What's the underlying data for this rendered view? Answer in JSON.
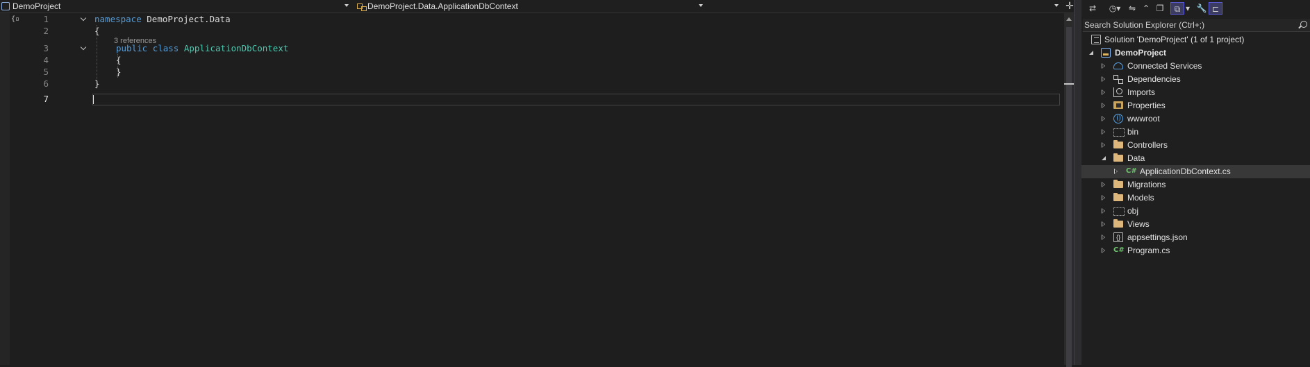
{
  "navbar": {
    "project": "DemoProject",
    "class_path": "DemoProject.Data.ApplicationDbContext",
    "member": ""
  },
  "editor": {
    "line_numbers": [
      "1",
      "2",
      "3",
      "4",
      "5",
      "6",
      "7"
    ],
    "current_line": "7",
    "codelens": "3 references",
    "code": {
      "l1_kw": "namespace",
      "l1_name": "DemoProject.Data",
      "l2": "{",
      "l3_kw1": "public",
      "l3_kw2": "class",
      "l3_type": "ApplicationDbContext",
      "l4": "{",
      "l5": "}",
      "l6": "}"
    }
  },
  "solution_explorer": {
    "search_placeholder": "Search Solution Explorer (Ctrl+;)",
    "items": [
      {
        "label": "Solution 'DemoProject' (1 of 1 project)",
        "icon": "solution-icon"
      },
      {
        "label": "DemoProject",
        "icon": "project-icon"
      },
      {
        "label": "Connected Services",
        "icon": "connected-services-icon"
      },
      {
        "label": "Dependencies",
        "icon": "dependencies-icon"
      },
      {
        "label": "Imports",
        "icon": "imports-icon"
      },
      {
        "label": "Properties",
        "icon": "properties-icon"
      },
      {
        "label": "wwwroot",
        "icon": "globe-icon"
      },
      {
        "label": "bin",
        "icon": "folder-icon"
      },
      {
        "label": "Controllers",
        "icon": "folder-icon"
      },
      {
        "label": "Data",
        "icon": "folder-icon"
      },
      {
        "label": "ApplicationDbContext.cs",
        "icon": "csharp-file-icon"
      },
      {
        "label": "Migrations",
        "icon": "folder-icon"
      },
      {
        "label": "Models",
        "icon": "folder-icon"
      },
      {
        "label": "obj",
        "icon": "folder-icon"
      },
      {
        "label": "Views",
        "icon": "folder-icon"
      },
      {
        "label": "appsettings.json",
        "icon": "json-file-icon"
      },
      {
        "label": "Program.cs",
        "icon": "csharp-file-icon"
      }
    ],
    "csharp_glyph": "C#",
    "json_glyph": "{}"
  },
  "colors": {
    "keyword": "#569cd6",
    "type": "#4ec9b0",
    "folder": "#dcb67a",
    "selection": "#383838"
  }
}
